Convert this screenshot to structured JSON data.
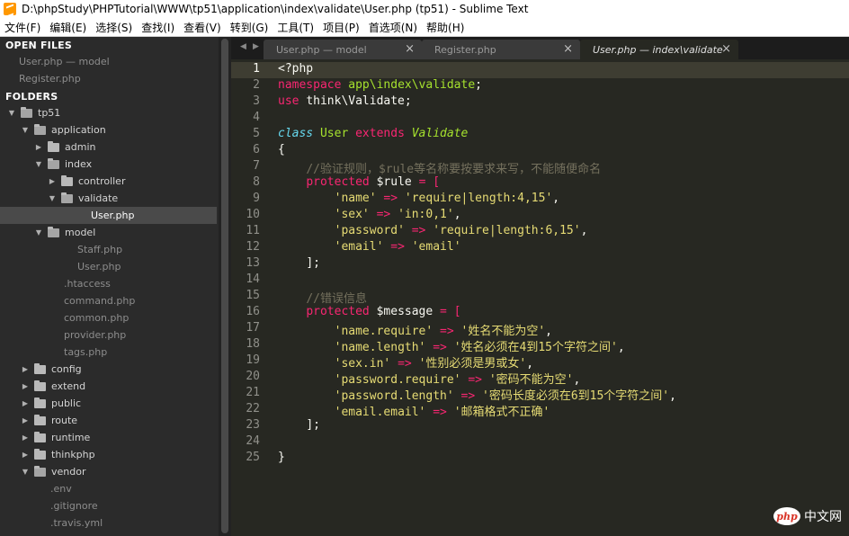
{
  "window": {
    "title": "D:\\phpStudy\\PHPTutorial\\WWW\\tp51\\application\\index\\validate\\User.php (tp51) - Sublime Text"
  },
  "menu": [
    "文件(F)",
    "编辑(E)",
    "选择(S)",
    "查找(I)",
    "查看(V)",
    "转到(G)",
    "工具(T)",
    "项目(P)",
    "首选项(N)",
    "帮助(H)"
  ],
  "sidebar": {
    "open_files_header": "OPEN FILES",
    "open_files": [
      "User.php — model",
      "Register.php"
    ],
    "folders_header": "FOLDERS",
    "tree": [
      {
        "label": "tp51",
        "kind": "folder",
        "open": true
      },
      {
        "label": "application",
        "kind": "folder",
        "open": true
      },
      {
        "label": "admin",
        "kind": "folder",
        "open": false
      },
      {
        "label": "index",
        "kind": "folder",
        "open": true
      },
      {
        "label": "controller",
        "kind": "folder",
        "open": false
      },
      {
        "label": "validate",
        "kind": "folder",
        "open": true
      },
      {
        "label": "User.php",
        "kind": "file",
        "selected": true
      },
      {
        "label": "model",
        "kind": "folder",
        "open": true
      },
      {
        "label": "Staff.php",
        "kind": "file"
      },
      {
        "label": "User.php",
        "kind": "file"
      },
      {
        "label": ".htaccess",
        "kind": "file"
      },
      {
        "label": "command.php",
        "kind": "file"
      },
      {
        "label": "common.php",
        "kind": "file"
      },
      {
        "label": "provider.php",
        "kind": "file"
      },
      {
        "label": "tags.php",
        "kind": "file"
      },
      {
        "label": "config",
        "kind": "folder",
        "open": false
      },
      {
        "label": "extend",
        "kind": "folder",
        "open": false
      },
      {
        "label": "public",
        "kind": "folder",
        "open": false
      },
      {
        "label": "route",
        "kind": "folder",
        "open": false
      },
      {
        "label": "runtime",
        "kind": "folder",
        "open": false
      },
      {
        "label": "thinkphp",
        "kind": "folder",
        "open": false
      },
      {
        "label": "vendor",
        "kind": "folder",
        "open": true
      },
      {
        "label": ".env",
        "kind": "file"
      },
      {
        "label": ".gitignore",
        "kind": "file"
      },
      {
        "label": ".travis.yml",
        "kind": "file"
      }
    ]
  },
  "tabs": [
    {
      "label": "User.php — model",
      "active": false
    },
    {
      "label": "Register.php",
      "active": false
    },
    {
      "label": "User.php — index\\validate",
      "active": true
    }
  ],
  "tab_nav": {
    "left": "◀",
    "right": "▶",
    "close": "×"
  },
  "editor": {
    "current_line": 1,
    "line_numbers": [
      "1",
      "2",
      "3",
      "4",
      "5",
      "6",
      "7",
      "8",
      "9",
      "10",
      "11",
      "12",
      "13",
      "14",
      "15",
      "16",
      "17",
      "18",
      "19",
      "20",
      "21",
      "22",
      "23",
      "24",
      "25"
    ],
    "code": {
      "l1": "<?php",
      "l2_kw": "namespace",
      "l2_ns": "app\\index\\validate",
      "l3_kw": "use",
      "l3_ns": "think\\Validate",
      "l5_class": "class",
      "l5_name": "User",
      "l5_extends": "extends",
      "l5_parent": "Validate",
      "l6": "{",
      "l7_comment": "//验证规则，$rule等名称要按要求来写，不能随便命名",
      "l8_kw": "protected",
      "l8_var": "$rule",
      "l8_op": "= [",
      "rules": [
        {
          "key": "'name'",
          "arrow": "=>",
          "val": "'require|length:4,15'"
        },
        {
          "key": "'sex'",
          "arrow": "=>",
          "val": "'in:0,1'"
        },
        {
          "key": "'password'",
          "arrow": "=>",
          "val": "'require|length:6,15'"
        },
        {
          "key": "'email'",
          "arrow": "=>",
          "val": "'email'"
        }
      ],
      "l13": "];",
      "l15_comment": "//错误信息",
      "l16_kw": "protected",
      "l16_var": "$message",
      "l16_op": "= [",
      "messages": [
        {
          "key": "'name.require'",
          "arrow": "=>",
          "val": "'姓名不能为空'"
        },
        {
          "key": "'name.length'",
          "arrow": "=>",
          "val": "'姓名必须在4到15个字符之间'"
        },
        {
          "key": "'sex.in'",
          "arrow": "=>",
          "val": "'性别必须是男或女'"
        },
        {
          "key": "'password.require'",
          "arrow": "=>",
          "val": "'密码不能为空'"
        },
        {
          "key": "'password.length'",
          "arrow": "=>",
          "val": "'密码长度必须在6到15个字符之间'"
        },
        {
          "key": "'email.email'",
          "arrow": "=>",
          "val": "'邮箱格式不正确'"
        }
      ],
      "l23": "];",
      "l25": "}"
    }
  },
  "watermark": {
    "logo": "php",
    "text": "中文网"
  },
  "colors": {
    "editor_bg": "#272822",
    "keyword": "#f92672",
    "string": "#e6db74",
    "comment": "#75715e",
    "type": "#66d9ef",
    "name": "#a6e22e"
  }
}
